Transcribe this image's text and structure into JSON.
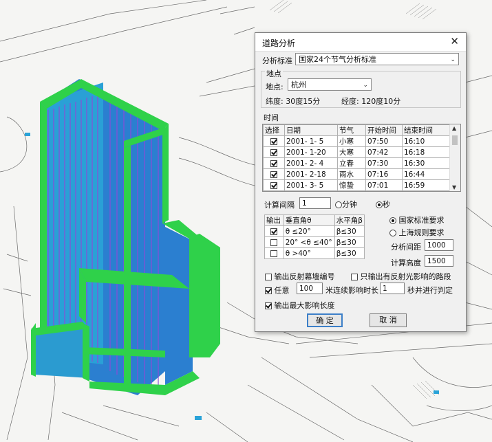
{
  "dialog": {
    "title": "道路分析",
    "standard_label": "分析标准",
    "standard_value": "国家24个节气分析标准",
    "location_group": "地点",
    "location_label": "地点:",
    "location_value": "杭州",
    "latitude": "纬度:   30度15分",
    "longitude": "经度:   120度10分",
    "time_group": "时间",
    "time_table": {
      "headers": [
        "选择",
        "日期",
        "节气",
        "开始时间",
        "结束时间"
      ],
      "rows": [
        {
          "checked": true,
          "date": "2001- 1- 5",
          "term": "小寒",
          "start": "07:50",
          "end": "16:10"
        },
        {
          "checked": true,
          "date": "2001- 1-20",
          "term": "大寒",
          "start": "07:42",
          "end": "16:18"
        },
        {
          "checked": true,
          "date": "2001- 2- 4",
          "term": "立春",
          "start": "07:30",
          "end": "16:30"
        },
        {
          "checked": true,
          "date": "2001- 2-18",
          "term": "雨水",
          "start": "07:16",
          "end": "16:44"
        },
        {
          "checked": true,
          "date": "2001- 3- 5",
          "term": "惊蛰",
          "start": "07:01",
          "end": "16:59"
        }
      ]
    },
    "interval_label": "计算间隔",
    "interval_value": "1",
    "unit_minute": "分钟",
    "unit_second": "秒",
    "angle_table": {
      "headers": [
        "输出",
        "垂直角θ",
        "水平角β"
      ],
      "rows": [
        {
          "checked": true,
          "vertical": "θ ≤20°",
          "horizontal": "β≤30"
        },
        {
          "checked": false,
          "vertical": "20° <θ ≤40°",
          "horizontal": "β≤30"
        },
        {
          "checked": false,
          "vertical": "θ >40°",
          "horizontal": "β≤30"
        }
      ]
    },
    "rule_national": "国家标准要求",
    "rule_shanghai": "上海规则要求",
    "distance_label": "分析间距",
    "distance_value": "1000",
    "height_label": "计算高度",
    "height_value": "1500",
    "opt_output_curtain": "输出反射幕墙编号",
    "opt_only_affected": "只输出有反射光影响的路段",
    "opt_any_label": "任意",
    "opt_any_value": "100",
    "opt_any_mid": "米连续影响时长",
    "opt_duration_value": "1",
    "opt_any_tail": "秒并进行判定",
    "opt_max_length": "输出最大影响长度",
    "ok": "确 定",
    "cancel": "取 消"
  },
  "colors": {
    "building_face": "#2a9fd4",
    "building_frame": "#2fd14a",
    "dialog_bg": "#f0f0f0"
  }
}
